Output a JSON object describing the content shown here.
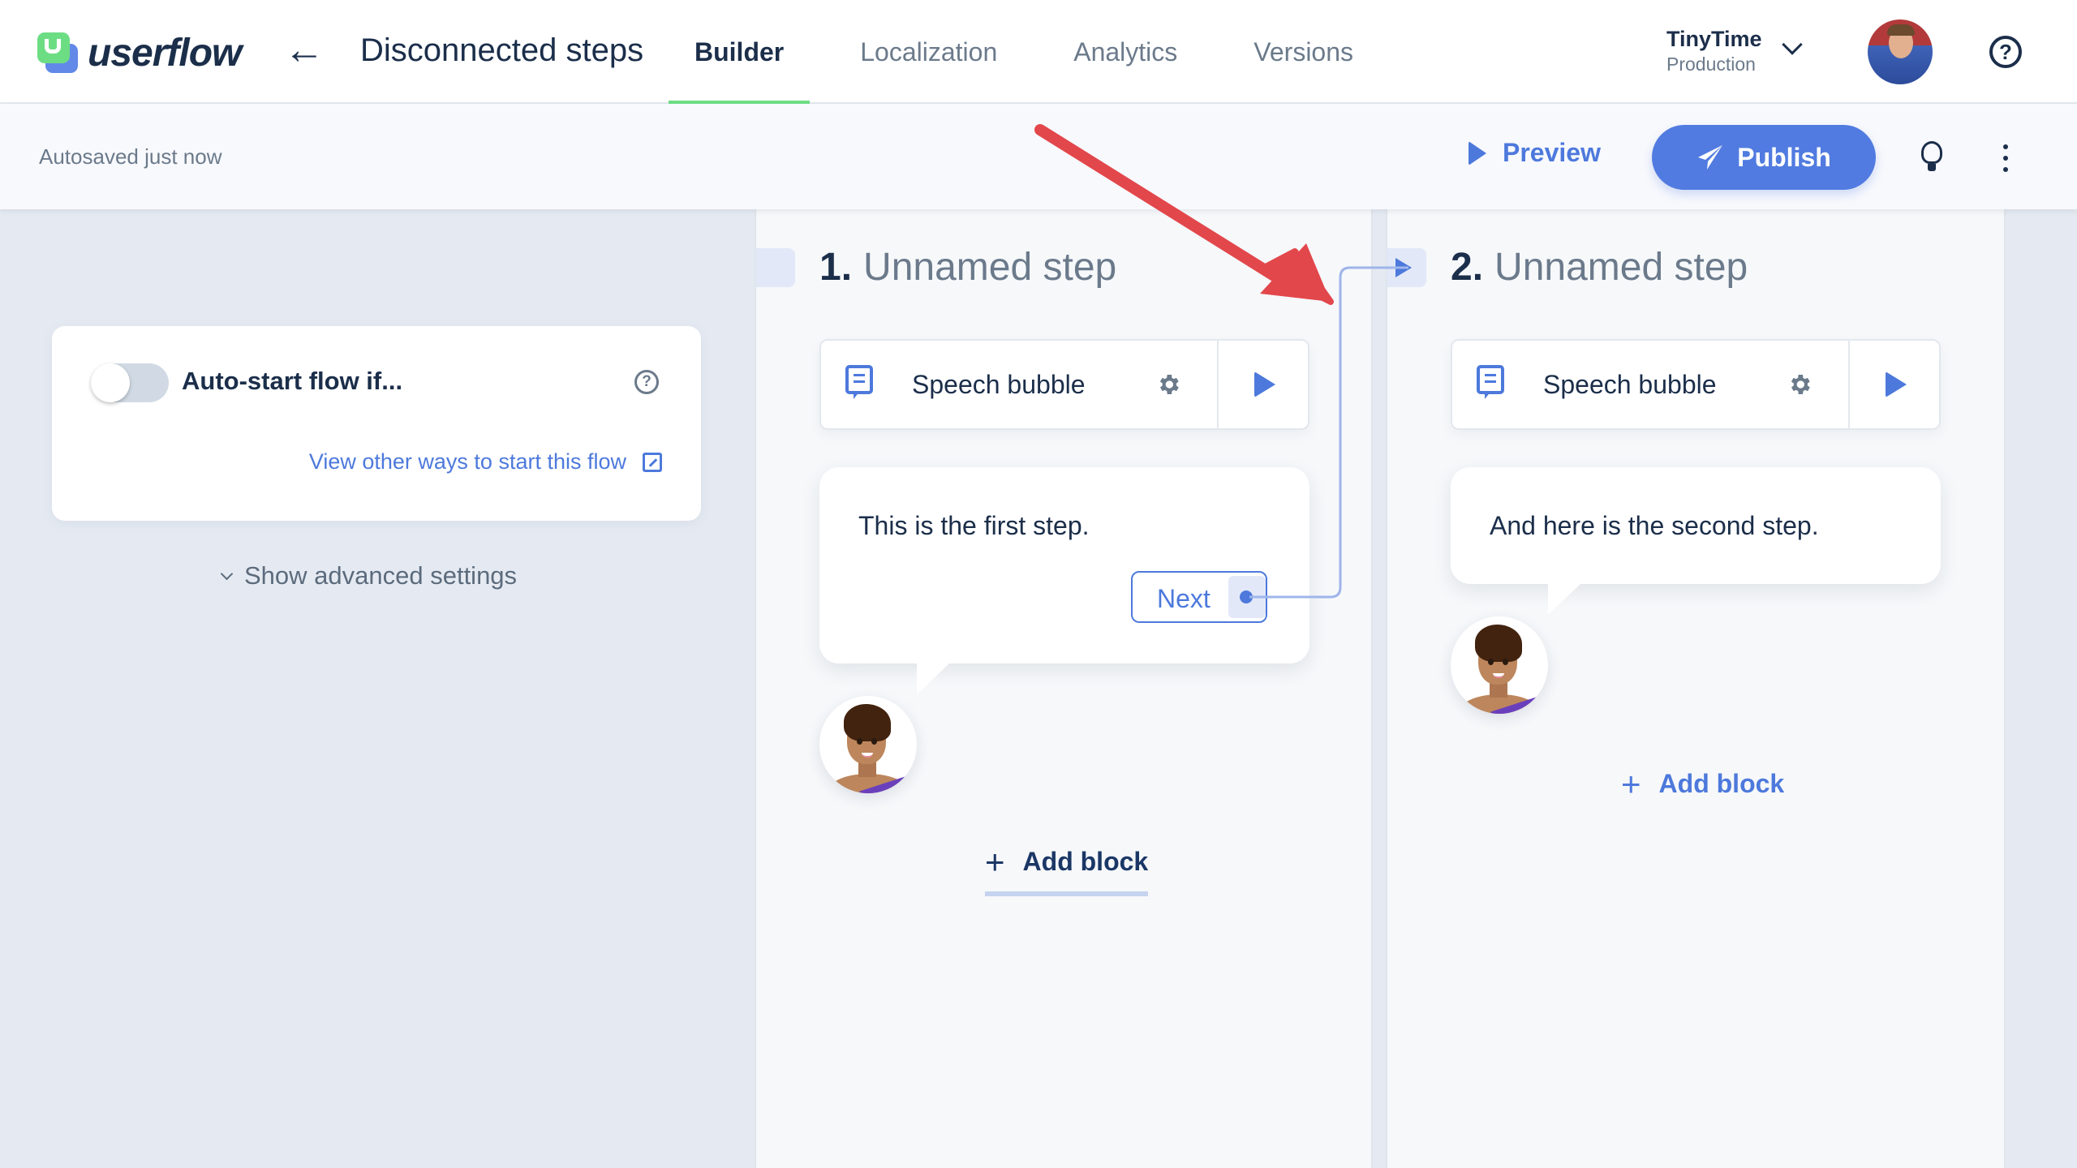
{
  "header": {
    "brand": "userflow",
    "back_label": "←",
    "flow_title": "Disconnected steps",
    "tabs": [
      {
        "label": "Builder",
        "active": true
      },
      {
        "label": "Localization",
        "active": false
      },
      {
        "label": "Analytics",
        "active": false
      },
      {
        "label": "Versions",
        "active": false
      }
    ],
    "account": {
      "name": "TinyTime",
      "environment": "Production"
    },
    "help_label": "?"
  },
  "subheader": {
    "status": "Autosaved just now",
    "preview_label": "Preview",
    "publish_label": "Publish"
  },
  "settings": {
    "auto_start_label": "Auto-start flow if...",
    "auto_start_enabled": false,
    "help_label": "?",
    "other_ways_link": "View other ways to start this flow",
    "advanced_label": "Show advanced settings"
  },
  "steps": [
    {
      "number": "1.",
      "name": "Unnamed step",
      "block": {
        "type_label": "Speech bubble",
        "icon": "speech-bubble-icon"
      },
      "bubble_text": "This is the first step.",
      "button_label": "Next",
      "add_block_label": "Add block",
      "add_block_plus": "+"
    },
    {
      "number": "2.",
      "name": "Unnamed step",
      "block": {
        "type_label": "Speech bubble",
        "icon": "speech-bubble-icon"
      },
      "bubble_text": "And here is the second step.",
      "add_block_label": "Add block",
      "add_block_plus": "+"
    }
  ],
  "colors": {
    "accent": "#517be0",
    "tab_active_underline": "#6ddd84",
    "annotation_arrow": "#e2474b",
    "connector": "#9fb5ea",
    "text_dark": "#1b2e4a",
    "text_muted": "#6b7a8b"
  }
}
